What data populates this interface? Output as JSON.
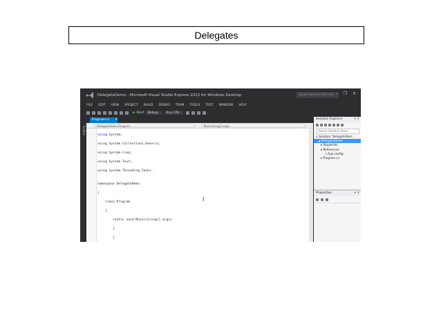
{
  "slide": {
    "title": "Delegates"
  },
  "vs": {
    "window_title": "DelegateDemo - Microsoft Visual Studio Express 2012 for Windows Desktop",
    "quick_launch": "Quick Launch (Ctrl+Q)",
    "window_controls": "– ❐ ✕",
    "menu": [
      "FILE",
      "EDIT",
      "VIEW",
      "PROJECT",
      "BUILD",
      "DEBUG",
      "TEAM",
      "TOOLS",
      "TEST",
      "WINDOW",
      "HELP"
    ],
    "toolbar": {
      "start_label": "Start",
      "config": "Debug",
      "platform": "Any CPU"
    },
    "side_strip_label": "Toolbox",
    "doc_tab": {
      "label": "Program.cs",
      "close": "✕"
    },
    "nav": {
      "left": "DelegateDemo.Program",
      "right": "Main(string[] args)"
    },
    "code_lines": [
      "using System;",
      "using System.Collections.Generic;",
      "using System.Linq;",
      "using System.Text;",
      "using System.Threading.Tasks;",
      "",
      "namespace DelegateDemo",
      "{",
      "    class Program",
      "    {",
      "        static void Main(string[] args)",
      "        {",
      "        }",
      "    }",
      "}"
    ],
    "cursor": "I",
    "solution_explorer": {
      "header": "Solution Explorer",
      "pin": "▾ ✕",
      "search_placeholder": "Search Solution Explo",
      "items": [
        "Solution 'DelegateDem",
        "DelegateDemo",
        "Properties",
        "References",
        "App.config",
        "Program.cs"
      ]
    },
    "properties": {
      "header": "Properties",
      "pin": "▾ ✕"
    }
  }
}
